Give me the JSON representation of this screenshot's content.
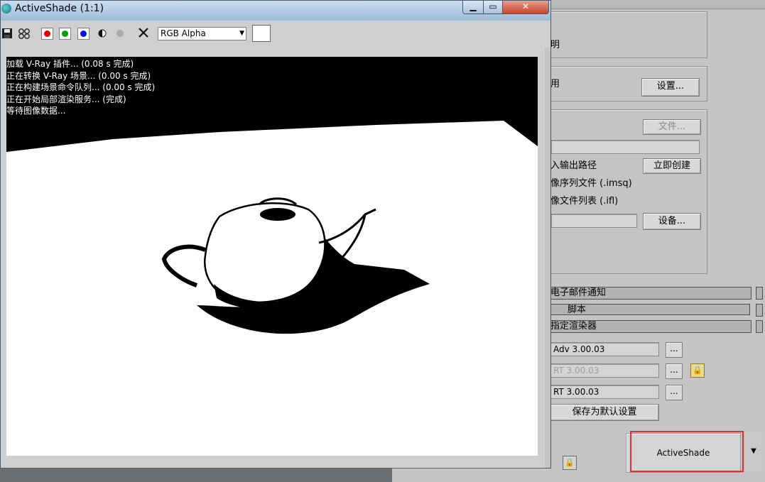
{
  "window": {
    "title": "ActiveShade (1:1)",
    "close_label": "✕",
    "minimize_label": "▁",
    "maximize_label": "▭"
  },
  "toolbar": {
    "channel_select": "RGB Alpha",
    "red_color": "#e00000",
    "green_color": "#00a000",
    "blue_color": "#0010e0"
  },
  "log_lines": [
    "加载 V-Ray 插件... (0.08 s 完成)",
    "正在转换 V-Ray 场景... (0.00 s 完成)",
    "正在构建场景命令队列... (0.00 s 完成)",
    "正在开始局部渲染服务... (完成)",
    "等待图像数据..."
  ],
  "setup_panel": {
    "label_tail_1": "明",
    "label_tail_2": "用",
    "setup_btn_1": "设置...",
    "file_btn": "文件...",
    "output_path_label": "入输出路径",
    "create_now_btn": "立即创建",
    "imsq_label": "像序列文件 (.imsq)",
    "ifl_label": "像文件列表 (.ifl)",
    "setup_btn_2": "设备...",
    "rollout_email": "电子邮件通知",
    "rollout_script": "脚本",
    "rollout_renderer": "指定渲染器",
    "renderer_prod": "Adv 3.00.03",
    "renderer_mat": "RT 3.00.03",
    "renderer_as": "RT 3.00.03",
    "ellipsis": "...",
    "save_default_btn": "保存为默认设置",
    "activeshade_btn": "ActiveShade"
  }
}
